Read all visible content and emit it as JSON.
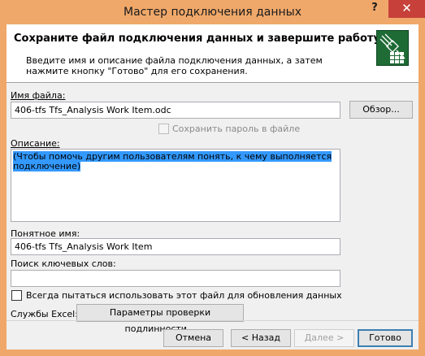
{
  "window": {
    "title": "Мастер подключения данных",
    "help_glyph": "?",
    "close_glyph": "✕"
  },
  "header": {
    "title": "Сохраните файл подключения данных и завершите работу",
    "description": "Введите имя и описание файла подключения данных, а затем нажмите кнопку \"Готово\" для его сохранения.",
    "icon": "data-connection-wizard-icon"
  },
  "file_name": {
    "label": "Имя файла:",
    "value": "406-tfs Tfs_Analysis Work Item.odc",
    "browse_label": "Обзор..."
  },
  "save_password": {
    "label": "Сохранить пароль в файле",
    "checked": false,
    "enabled": false
  },
  "description": {
    "label": "Описание:",
    "value": "(Чтобы помочь другим пользователям понять, к чему выполняется подключение)"
  },
  "friendly_name": {
    "label": "Понятное имя:",
    "value": "406-tfs Tfs_Analysis Work Item"
  },
  "keywords": {
    "label": "Поиск ключевых слов:",
    "value": ""
  },
  "always_use": {
    "label": "Всегда пытаться использовать этот файл для обновления данных",
    "checked": false
  },
  "excel_services": {
    "label": "Службы Excel:",
    "button_label": "Параметры проверки подлинности..."
  },
  "footer": {
    "cancel_label": "Отмена",
    "back_label": "< Назад",
    "next_label": "Далее >",
    "finish_label": "Готово"
  }
}
